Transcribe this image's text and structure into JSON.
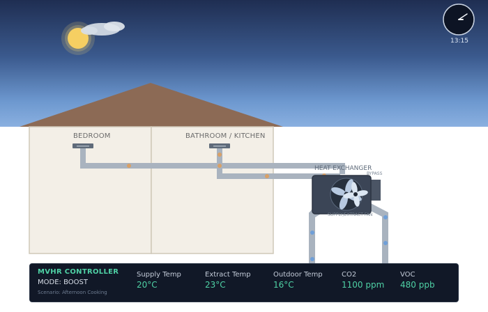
{
  "clock": {
    "time": "13:15"
  },
  "rooms": [
    {
      "label": "BEDROOM"
    },
    {
      "label": "BATHROOM / KITCHEN"
    }
  ],
  "unit": {
    "label": "HEAT EXCHANGER",
    "bypass_label": "BYPASS",
    "fan_label": "SUPPLY/EXTRACT FAN"
  },
  "controller": {
    "title": "MVHR CONTROLLER",
    "mode": "MODE: BOOST",
    "scenario": "Scenario: Afternoon Cooking",
    "metrics": [
      {
        "label": "Supply Temp",
        "value": "20°C"
      },
      {
        "label": "Extract Temp",
        "value": "23°C"
      },
      {
        "label": "Outdoor Temp",
        "value": "16°C"
      },
      {
        "label": "CO2",
        "value": "1100 ppm"
      },
      {
        "label": "VOC",
        "value": "480 ppb"
      }
    ]
  },
  "colors": {
    "accent": "#4fd1a5",
    "duct": "#a9b3bf",
    "warm_airflow": "#d9a066",
    "cool_airflow": "#6f9fd8",
    "roof": "#8c6a55",
    "wall": "#f3efe7"
  }
}
